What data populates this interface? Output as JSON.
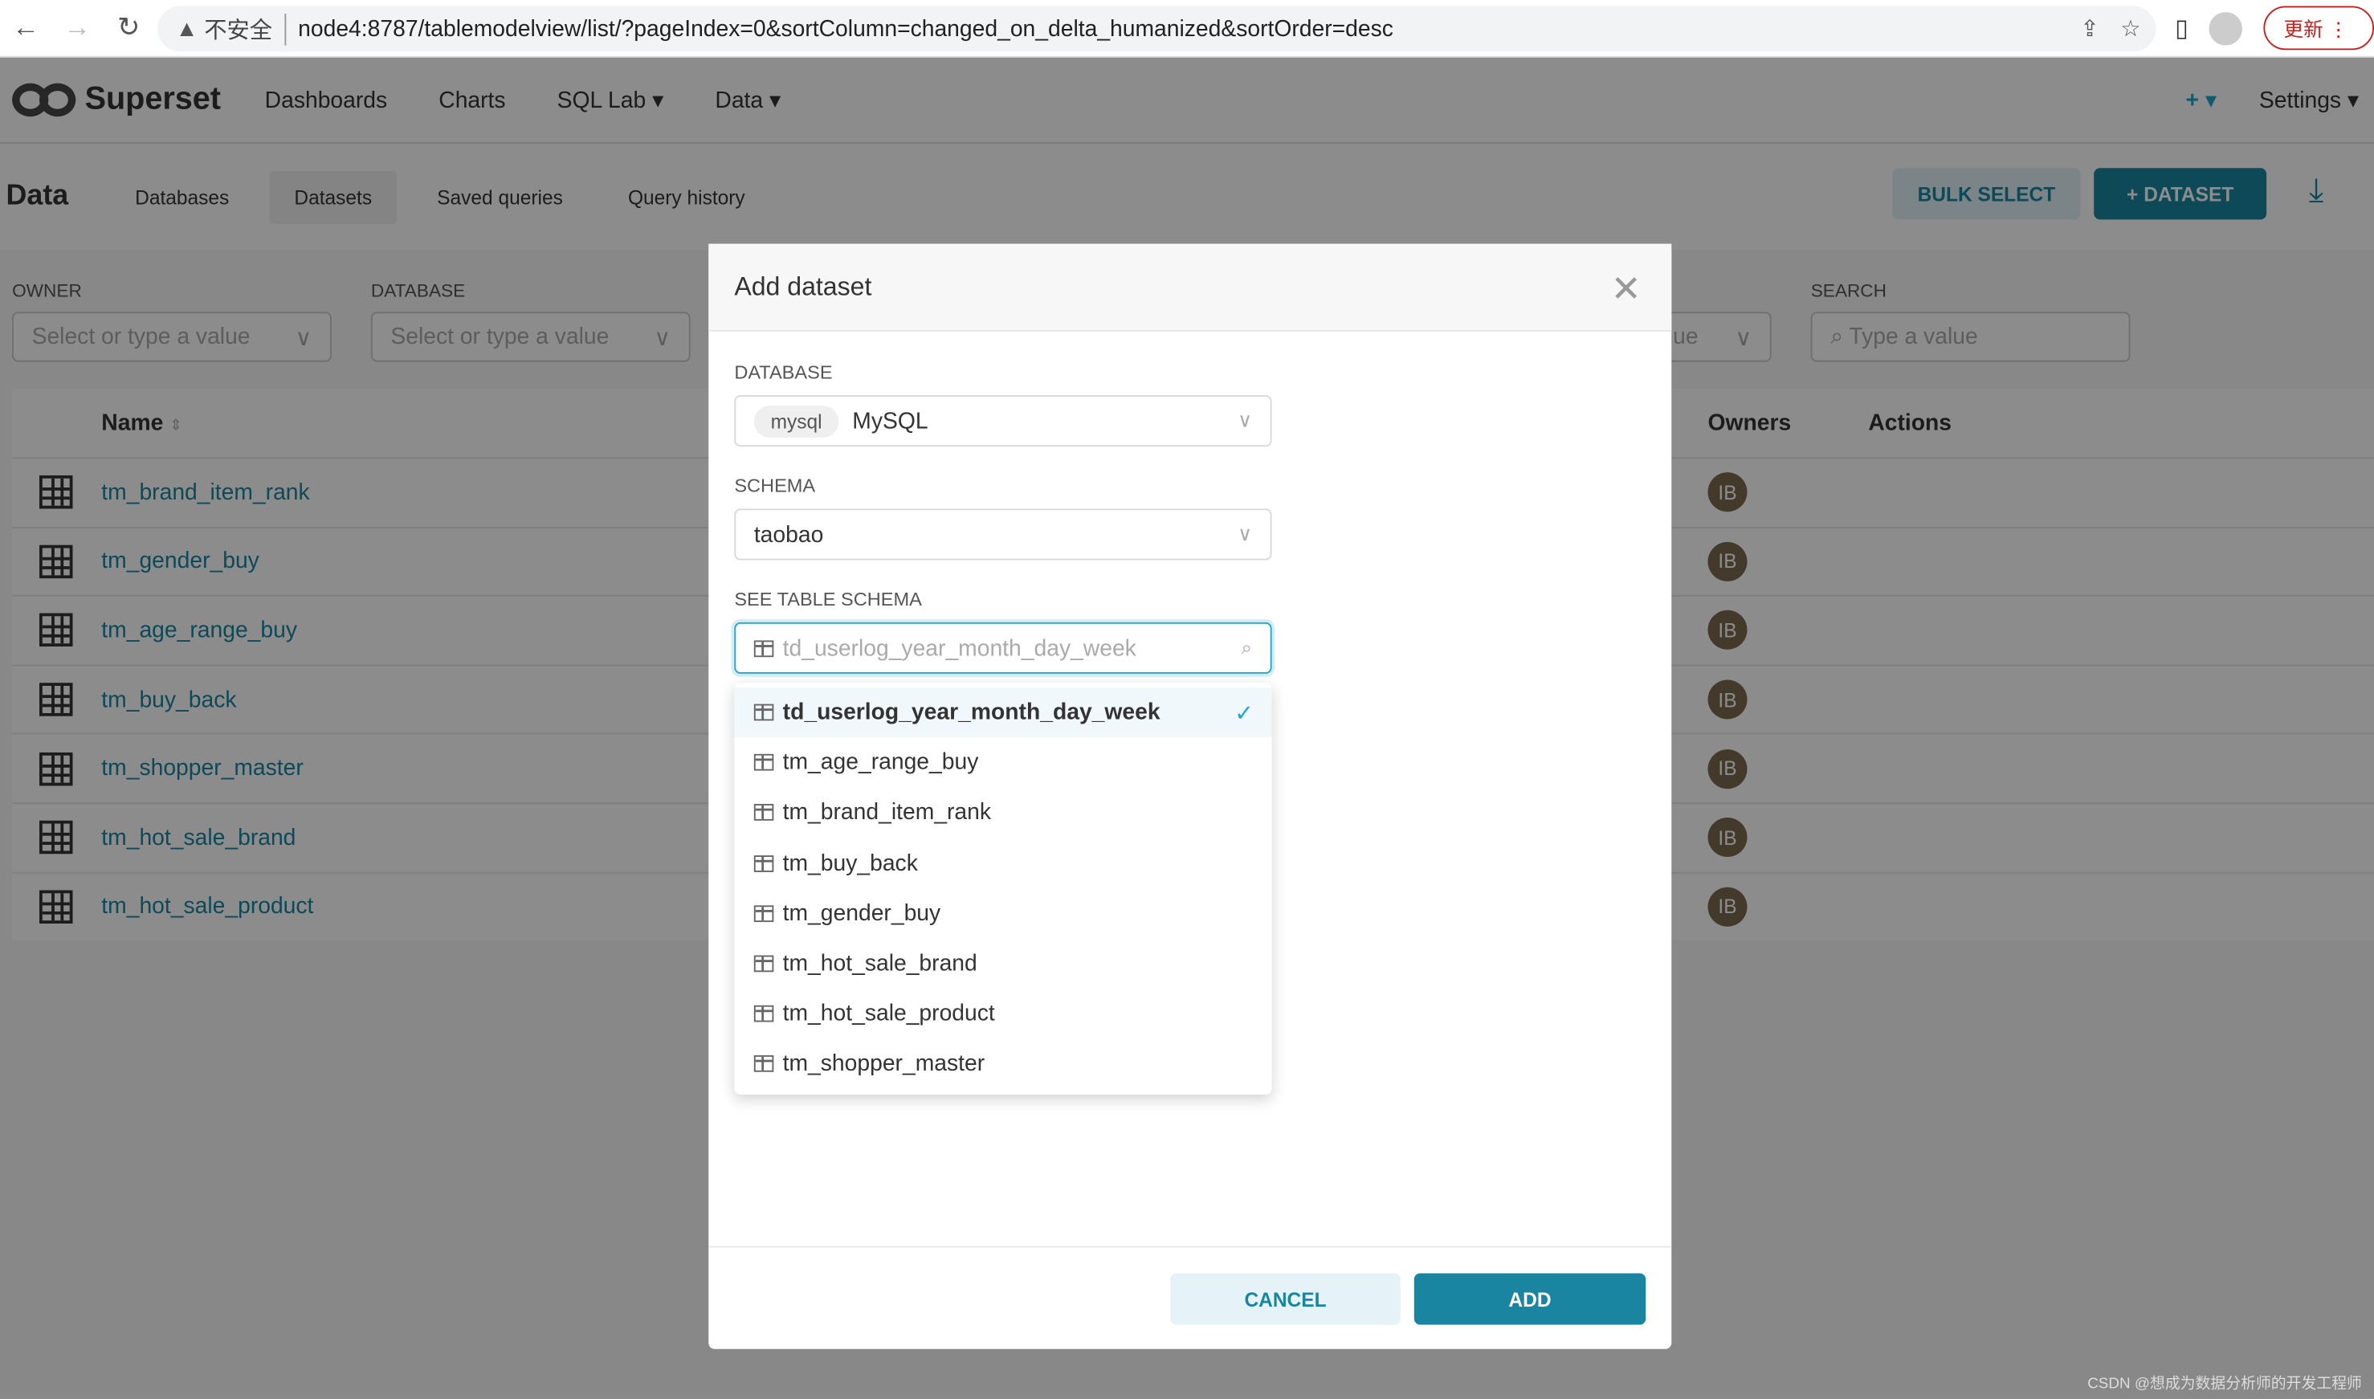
{
  "browser": {
    "insecure_label": "不安全",
    "url": "node4:8787/tablemodelview/list/?pageIndex=0&sortColumn=changed_on_delta_humanized&sortOrder=desc",
    "update_label": "更新"
  },
  "nav": {
    "brand": "Superset",
    "items": [
      "Dashboards",
      "Charts",
      "SQL Lab ▾",
      "Data ▾"
    ],
    "plus": "+ ▾",
    "settings": "Settings ▾"
  },
  "subnav": {
    "title": "Data",
    "tabs": [
      "Databases",
      "Datasets",
      "Saved queries",
      "Query history"
    ],
    "active_tab": "Datasets",
    "bulk_select": "BULK SELECT",
    "dataset_button": "DATASET"
  },
  "filters": {
    "owner_label": "OWNER",
    "owner_placeholder": "Select or type a value",
    "database_label": "DATABASE",
    "database_placeholder": "Select or type a value",
    "hidden_partial": "ue",
    "search_label": "SEARCH",
    "search_placeholder": "Type a value"
  },
  "table": {
    "headers": {
      "name": "Name",
      "owners": "Owners",
      "actions": "Actions"
    },
    "rows": [
      {
        "name": "tm_brand_item_rank",
        "owner": "IB"
      },
      {
        "name": "tm_gender_buy",
        "owner": "IB"
      },
      {
        "name": "tm_age_range_buy",
        "owner": "IB"
      },
      {
        "name": "tm_buy_back",
        "owner": "IB"
      },
      {
        "name": "tm_shopper_master",
        "owner": "IB"
      },
      {
        "name": "tm_hot_sale_brand",
        "owner": "IB"
      },
      {
        "name": "tm_hot_sale_product",
        "owner": "IB"
      }
    ]
  },
  "modal": {
    "title": "Add dataset",
    "database_label": "DATABASE",
    "database_tag": "mysql",
    "database_value": "MySQL",
    "schema_label": "SCHEMA",
    "schema_value": "taobao",
    "table_label": "SEE TABLE SCHEMA",
    "table_value": "td_userlog_year_month_day_week",
    "options": [
      "td_userlog_year_month_day_week",
      "tm_age_range_buy",
      "tm_brand_item_rank",
      "tm_buy_back",
      "tm_gender_buy",
      "tm_hot_sale_brand",
      "tm_hot_sale_product",
      "tm_shopper_master"
    ],
    "selected_option": "td_userlog_year_month_day_week",
    "cancel": "CANCEL",
    "add": "ADD"
  },
  "watermark": "CSDN @想成为数据分析师的开发工程师",
  "colors": {
    "primary": "#1a85a0",
    "accent": "#20a7c9",
    "owner_avatar": "#7d6a4f"
  }
}
